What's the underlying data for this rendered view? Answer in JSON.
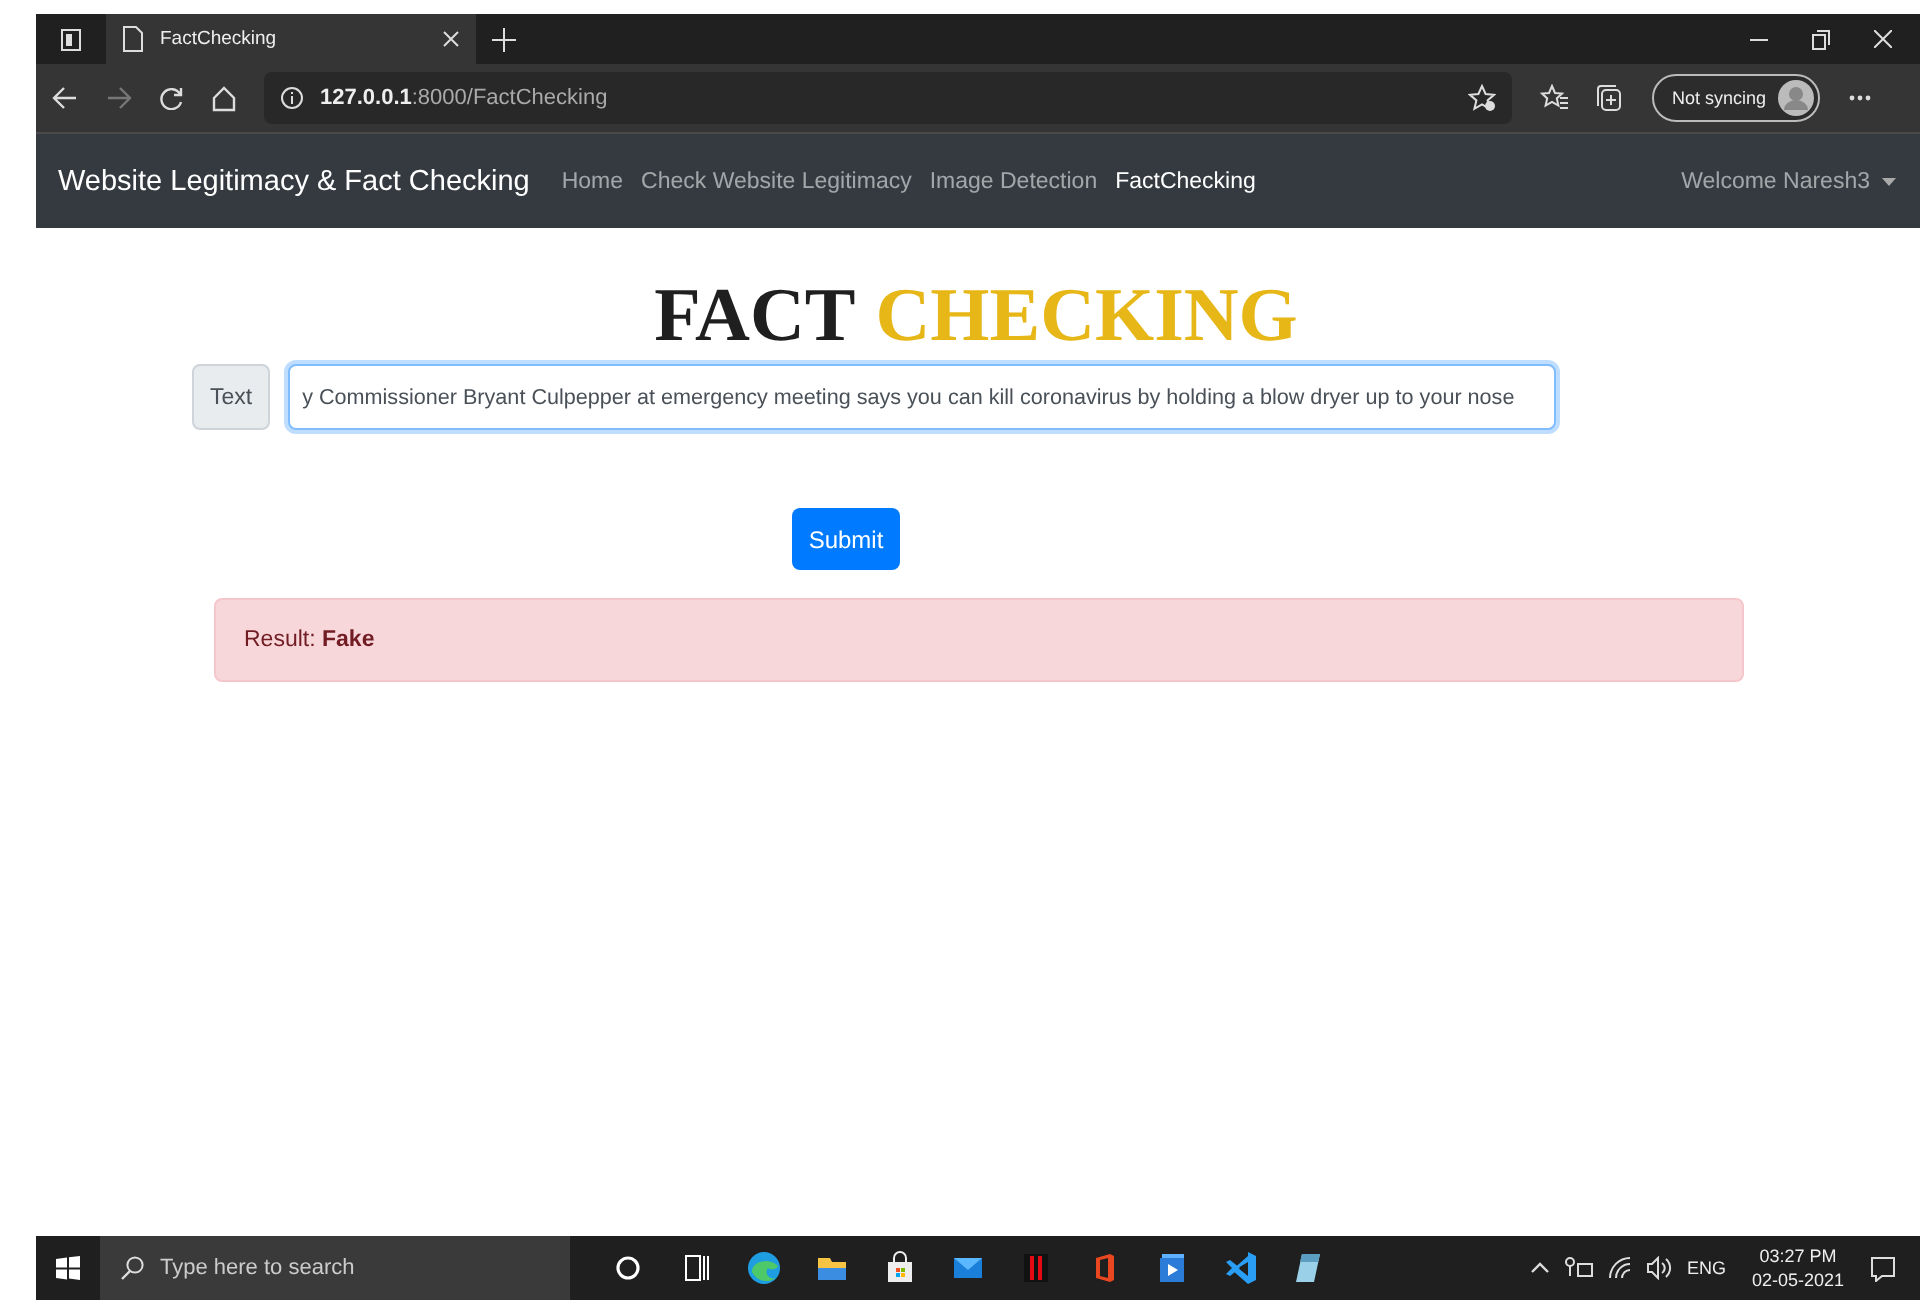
{
  "browser": {
    "tab_title": "FactChecking",
    "url_host": "127.0.0.1",
    "url_path": ":8000/FactChecking",
    "profile_label": "Not syncing"
  },
  "navbar": {
    "brand": "Website Legitimacy & Fact Checking",
    "links": [
      {
        "label": "Home",
        "selected": false
      },
      {
        "label": "Check Website Legitimacy",
        "selected": false
      },
      {
        "label": "Image Detection",
        "selected": false
      },
      {
        "label": "FactChecking",
        "selected": true
      }
    ],
    "user": "Welcome Naresh3"
  },
  "heading": [
    {
      "text": "FACT",
      "color": "#1f1f1f"
    },
    {
      "text": "CHECKING",
      "color": "#e6b717"
    }
  ],
  "form": {
    "prefix": "Text",
    "value": "y Commissioner Bryant Culpepper at emergency meeting says you can kill coronavirus by holding a blow dryer up to your nose",
    "button": "Submit"
  },
  "alert": {
    "kind": "danger",
    "text": "Result: **Fake**"
  },
  "taskbar": {
    "search_placeholder": "Type here to search",
    "language": "ENG",
    "time": "03:27 PM",
    "date": "02-05-2021"
  }
}
